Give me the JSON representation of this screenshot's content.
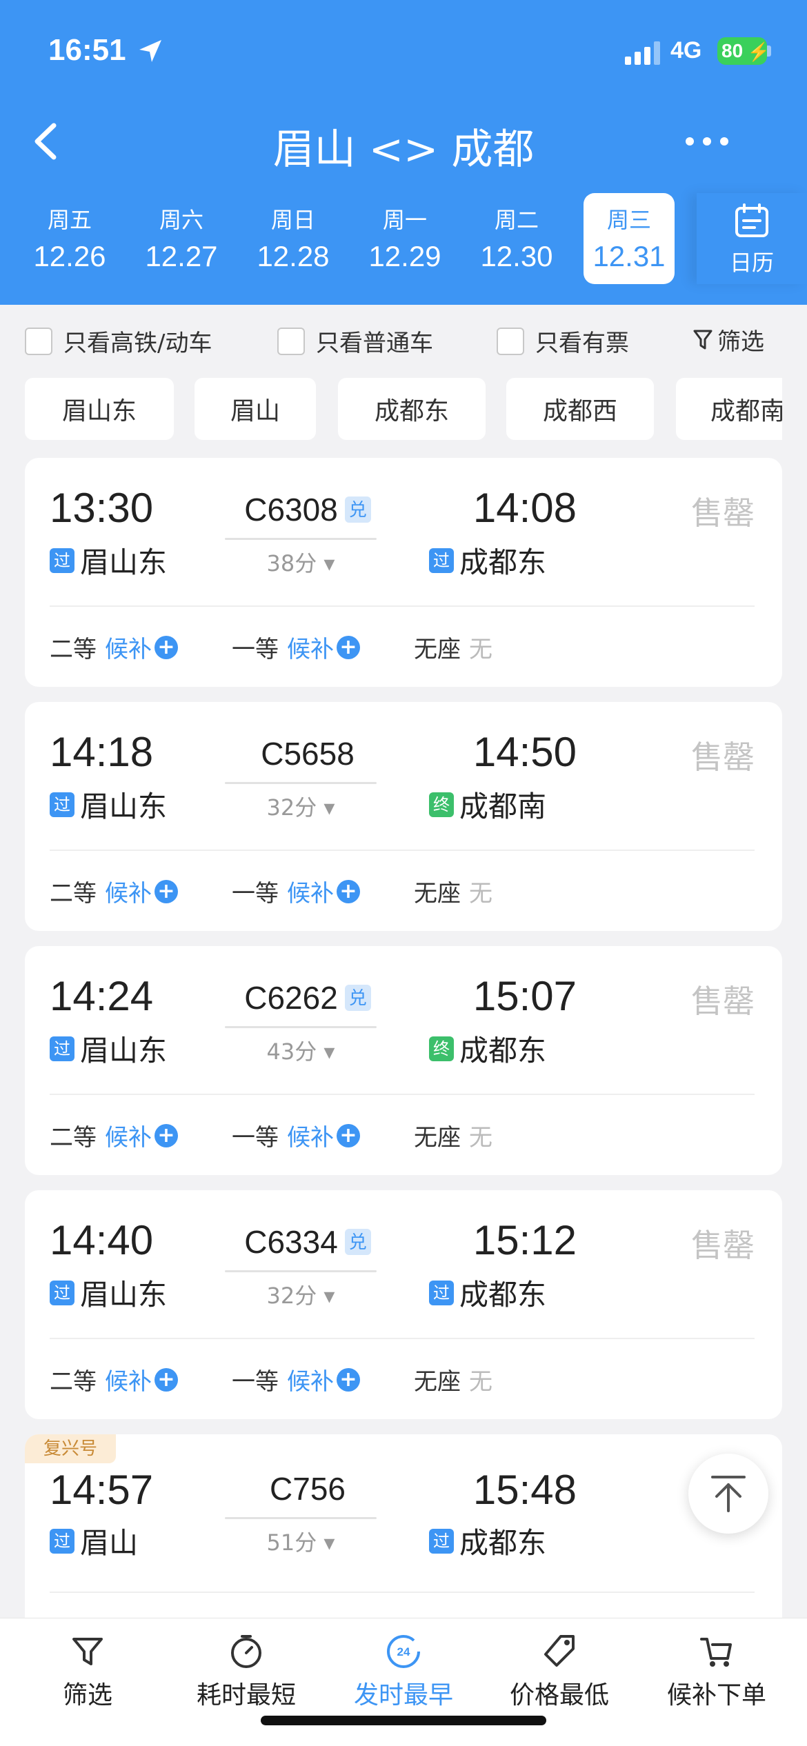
{
  "status_bar": {
    "time": "16:51",
    "network": "4G",
    "battery": "80"
  },
  "header": {
    "title": "眉山 <> 成都"
  },
  "dates": [
    {
      "weekday": "周五",
      "date": "12.26",
      "active": false
    },
    {
      "weekday": "周六",
      "date": "12.27",
      "active": false
    },
    {
      "weekday": "周日",
      "date": "12.28",
      "active": false
    },
    {
      "weekday": "周一",
      "date": "12.29",
      "active": false
    },
    {
      "weekday": "周二",
      "date": "12.30",
      "active": false
    },
    {
      "weekday": "周三",
      "date": "12.31",
      "active": true
    }
  ],
  "calendar_label": "日历",
  "filters": {
    "high_speed_only": "只看高铁/动车",
    "normal_only": "只看普通车",
    "available_only": "只看有票",
    "filter": "筛选"
  },
  "stations": [
    "眉山东",
    "眉山",
    "成都东",
    "成都西",
    "成都南"
  ],
  "trains": [
    {
      "dep_time": "13:30",
      "train_no": "C6308",
      "exchange": true,
      "arr_time": "14:08",
      "duration": "38分",
      "dep_tag": "过",
      "dep_station": "眉山东",
      "arr_tag": "过",
      "arr_station": "成都东",
      "status": "售罄",
      "fuxing": false,
      "seats": [
        {
          "class": "二等",
          "state": "候补"
        },
        {
          "class": "一等",
          "state": "候补"
        },
        {
          "class": "无座",
          "state": "无"
        }
      ]
    },
    {
      "dep_time": "14:18",
      "train_no": "C5658",
      "exchange": false,
      "arr_time": "14:50",
      "duration": "32分",
      "dep_tag": "过",
      "dep_station": "眉山东",
      "arr_tag": "终",
      "arr_station": "成都南",
      "status": "售罄",
      "fuxing": false,
      "seats": [
        {
          "class": "二等",
          "state": "候补"
        },
        {
          "class": "一等",
          "state": "候补"
        },
        {
          "class": "无座",
          "state": "无"
        }
      ]
    },
    {
      "dep_time": "14:24",
      "train_no": "C6262",
      "exchange": true,
      "arr_time": "15:07",
      "duration": "43分",
      "dep_tag": "过",
      "dep_station": "眉山东",
      "arr_tag": "终",
      "arr_station": "成都东",
      "status": "售罄",
      "fuxing": false,
      "seats": [
        {
          "class": "二等",
          "state": "候补"
        },
        {
          "class": "一等",
          "state": "候补"
        },
        {
          "class": "无座",
          "state": "无"
        }
      ]
    },
    {
      "dep_time": "14:40",
      "train_no": "C6334",
      "exchange": true,
      "arr_time": "15:12",
      "duration": "32分",
      "dep_tag": "过",
      "dep_station": "眉山东",
      "arr_tag": "过",
      "arr_station": "成都东",
      "status": "售罄",
      "fuxing": false,
      "seats": [
        {
          "class": "二等",
          "state": "候补"
        },
        {
          "class": "一等",
          "state": "候补"
        },
        {
          "class": "无座",
          "state": "无"
        }
      ]
    },
    {
      "dep_time": "14:57",
      "train_no": "C756",
      "exchange": false,
      "arr_time": "15:48",
      "duration": "51分",
      "dep_tag": "过",
      "dep_station": "眉山",
      "arr_tag": "过",
      "arr_station": "成都东",
      "status": "",
      "fuxing": true,
      "fuxing_label": "复兴号",
      "seats": []
    }
  ],
  "exchange_label": "兑",
  "tabs": [
    {
      "label": "筛选",
      "icon": "filter-icon",
      "active": false
    },
    {
      "label": "耗时最短",
      "icon": "timer-icon",
      "active": false
    },
    {
      "label": "发时最早",
      "icon": "clock-24-icon",
      "active": true
    },
    {
      "label": "价格最低",
      "icon": "price-tag-icon",
      "active": false
    },
    {
      "label": "候补下单",
      "icon": "cart-icon",
      "active": false
    }
  ],
  "colors": {
    "primary": "#3d95f4",
    "pass_tag": "#3d95f4",
    "end_tag": "#3cbf6b",
    "sold_out": "#c4c4c4",
    "battery": "#3ad05b"
  }
}
